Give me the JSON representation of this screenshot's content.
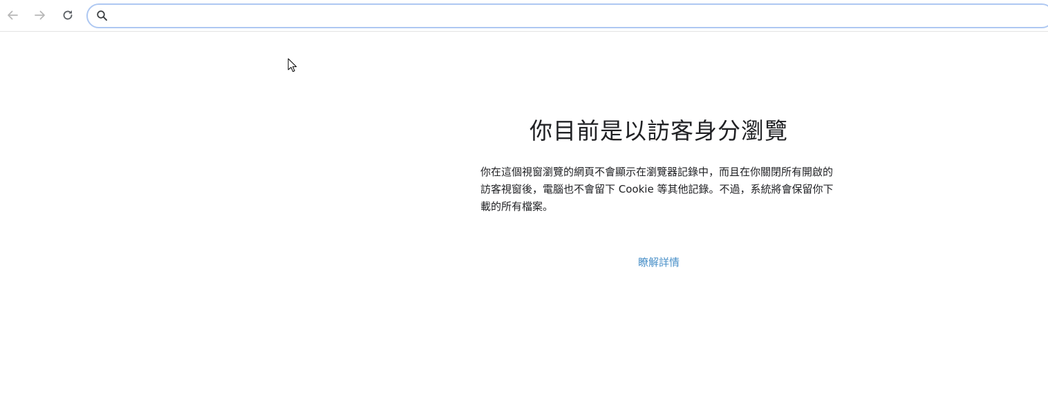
{
  "toolbar": {
    "back_icon": "arrow-left-icon",
    "forward_icon": "arrow-right-icon",
    "reload_icon": "reload-icon",
    "omnibox": {
      "icon": "search-icon",
      "value": "",
      "placeholder": ""
    },
    "colors": {
      "icon_disabled": "#b8b8b8",
      "icon_active": "#5f6368",
      "omnibox_border": "#aec8f2"
    }
  },
  "main": {
    "title": "你目前是以訪客身分瀏覽",
    "description": "你在這個視窗瀏覽的網頁不會顯示在瀏覽器記錄中，而且在你關閉所有開啟的訪客視窗後，電腦也不會留下 Cookie 等其他記錄。不過，系統將會保留你下載的所有檔案。",
    "learn_more": "瞭解詳情",
    "colors": {
      "text": "#202124",
      "link": "#4a90c8"
    }
  }
}
